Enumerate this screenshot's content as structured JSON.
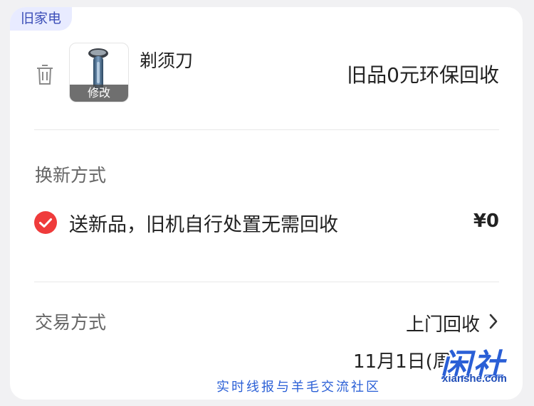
{
  "item_tag": "旧家电",
  "product": {
    "name": "剃须刀",
    "thumb_overlay": "修改",
    "recycle_note": "旧品0元环保回收"
  },
  "exchange": {
    "title": "换新方式",
    "option_label": "送新品，旧机自行处置无需回收",
    "option_price": "¥0",
    "selected": true
  },
  "transaction": {
    "title": "交易方式",
    "method": "上门回收",
    "date": "11月1日(周"
  },
  "watermark": {
    "logo": "闲社",
    "url": "xianshe.com",
    "slogan": "实时线报与羊毛交流社区"
  },
  "colors": {
    "accent_red": "#ef3b3b",
    "tag_bg": "#e8ebff",
    "tag_text": "#3d4fb8",
    "watermark_blue": "#2a5fd6"
  },
  "icons": {
    "trash": "trash-icon",
    "check": "check-circle-icon",
    "chevron": "chevron-right-icon"
  }
}
